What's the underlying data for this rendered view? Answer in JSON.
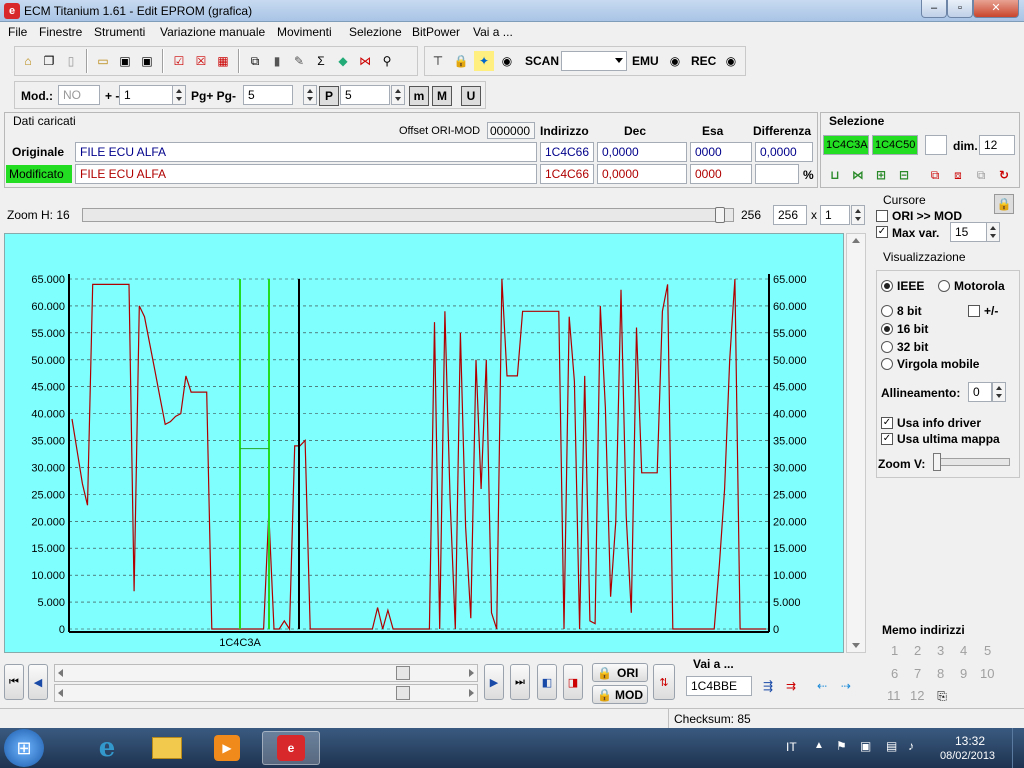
{
  "window": {
    "title": "ECM Titanium 1.61 - Edit EPROM (grafica)",
    "app_icon": "ecm-logo",
    "min": "–",
    "max": "▫",
    "close": "✕"
  },
  "menu": [
    "File",
    "Finestre",
    "Strumenti",
    "Variazione manuale",
    "Movimenti",
    "Selezione",
    "BitPower",
    "Vai a ..."
  ],
  "toolbar": {
    "scan_label": "SCAN",
    "emu_label": "EMU",
    "rec_label": "REC",
    "scan_select": ""
  },
  "toolbar2": {
    "mod_label": "Mod.:",
    "mod_value": "NO",
    "plusminus_label": "+ -",
    "step_value": "1",
    "pg_label": "Pg+ Pg-",
    "pg_value": "5",
    "p_value": "5",
    "p_icon": "P",
    "m_icon": "m",
    "M_icon": "M",
    "U_icon": "U"
  },
  "dati": {
    "title": "Dati caricati",
    "offset_label": "Offset ORI-MOD",
    "offset_value": "000000",
    "col_indirizzo": "Indirizzo",
    "col_dec": "Dec",
    "col_esa": "Esa",
    "col_diff": "Differenza",
    "originale": {
      "label": "Originale",
      "file": "FILE ECU ALFA",
      "addr": "1C4C66",
      "dec": "0,0000",
      "esa": "0000",
      "diff": "0,0000"
    },
    "modificato": {
      "label": "Modificato",
      "file": "FILE ECU ALFA",
      "addr": "1C4C66",
      "dec": "0,0000",
      "esa": "0000",
      "diff": "",
      "pct": "%"
    }
  },
  "selezione": {
    "title": "Selezione",
    "from": "1C4C3A",
    "to": "1C4C50",
    "extra": "",
    "dim_label": "dim.",
    "dim_value": "12"
  },
  "zoom": {
    "label": "Zoom H: 16",
    "value_label": "256",
    "field": "256",
    "x_label": "x",
    "mult": "1",
    "fill": 0.99
  },
  "cursore": {
    "title": "Cursore",
    "ori_mod": "ORI >> MOD",
    "ori_mod_checked": false,
    "maxvar": "Max var.",
    "maxvar_checked": true,
    "maxvar_value": "15"
  },
  "visual": {
    "title": "Visualizzazione",
    "ieee": "IEEE",
    "motorola": "Motorola",
    "b8": "8 bit",
    "pm": "+/-",
    "b16": "16 bit",
    "b32": "32 bit",
    "vm": "Virgola mobile",
    "alline_label": "Allineamento:",
    "alline_value": "0",
    "info_driver": "Usa info driver",
    "ultima_mappa": "Usa ultima mappa",
    "zoomv": "Zoom V:",
    "zoomv_level": 0.0
  },
  "memo": {
    "title": "Memo indirizzi",
    "items": [
      "1",
      "2",
      "3",
      "4",
      "5",
      "6",
      "7",
      "8",
      "9",
      "10",
      "11",
      "12"
    ]
  },
  "nav": {
    "ori_label": "ORI",
    "mod_label": "MOD",
    "vai_label": "Vai a ...",
    "vai_value": "1C4BBE",
    "slider1": 0.83,
    "slider2": 0.83
  },
  "status": {
    "checksum": "Checksum: 85"
  },
  "taskbar": {
    "lang": "IT",
    "time": "13:32",
    "date": "08/02/2013"
  },
  "chart_data": {
    "type": "line",
    "ylim": [
      0,
      65000
    ],
    "yticks": [
      "0",
      "5.000",
      "10.000",
      "15.000",
      "20.000",
      "25.000",
      "30.000",
      "35.000",
      "40.000",
      "45.000",
      "50.000",
      "55.000",
      "60.000",
      "65.000"
    ],
    "xlabel_marker": "1C4C3A",
    "background": "#80ffff",
    "line_color": "#b00000",
    "values": [
      39000,
      33000,
      27000,
      23000,
      64000,
      64000,
      64000,
      64000,
      64000,
      64000,
      64000,
      64000,
      7000,
      60000,
      58000,
      53000,
      48000,
      43000,
      38000,
      38500,
      39500,
      40000,
      47000,
      44000,
      44000,
      44000,
      44000,
      0,
      0,
      0,
      0,
      0,
      0,
      0,
      0,
      0,
      0,
      0,
      21500,
      0,
      0,
      1500,
      0,
      34000,
      34000,
      35000,
      0,
      0,
      0,
      0,
      0,
      0,
      0,
      0,
      0,
      0,
      0,
      0,
      0,
      4000,
      0,
      3500,
      0,
      0,
      0,
      0,
      0,
      0,
      0,
      0,
      57000,
      0,
      59000,
      24000,
      0,
      55000,
      19000,
      2000,
      50000,
      26000,
      50000,
      3000,
      0,
      65000,
      47000,
      47000,
      47000,
      59000,
      59000,
      59000,
      59000,
      59000,
      59000,
      59000,
      59000,
      0,
      58000,
      46000,
      0,
      47000,
      1500,
      1000,
      60000,
      41000,
      6000,
      20000,
      63000,
      21000,
      3000,
      56000,
      29000,
      29000,
      29000,
      29000,
      59000,
      64000,
      0,
      0,
      0,
      0,
      0,
      0,
      0,
      0,
      0,
      12000,
      26000,
      50000,
      65000,
      0,
      0,
      0,
      0,
      0,
      0
    ],
    "selection_markers": [
      "1C4C3A",
      "1C4C50"
    ]
  }
}
